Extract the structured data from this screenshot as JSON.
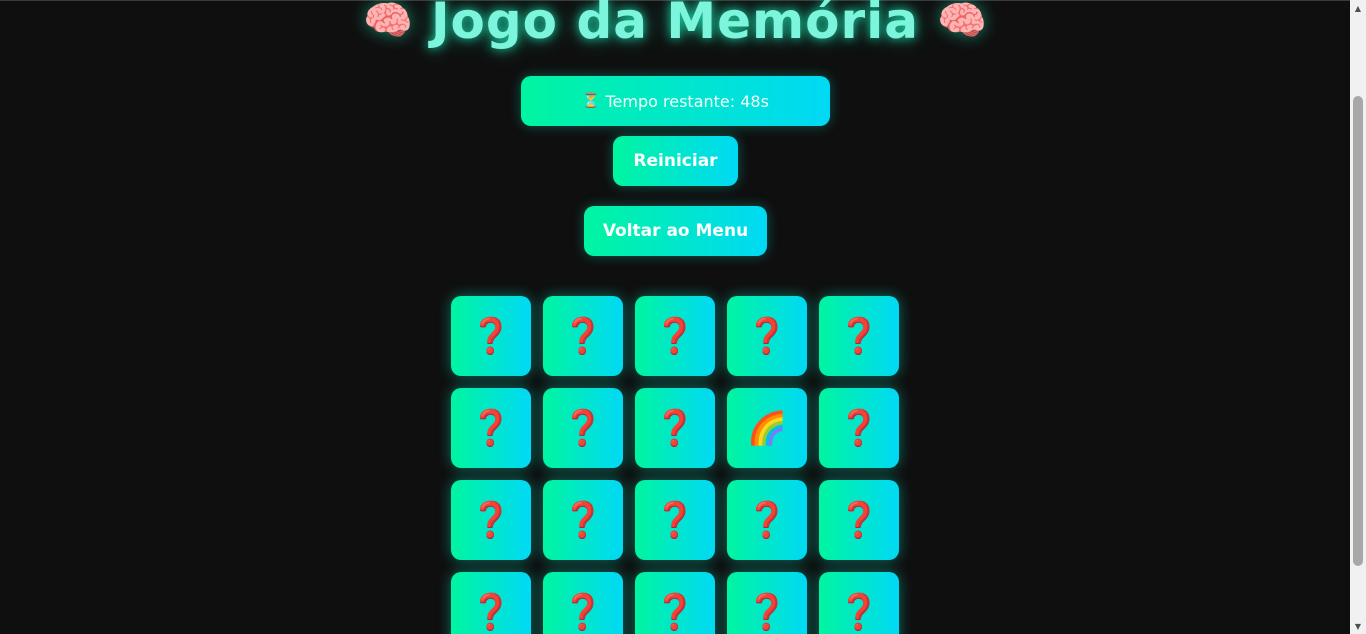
{
  "page": {
    "title": "Jogo da Memória",
    "title_icon": "brain-emoji",
    "title_icon_glyph": "🧠"
  },
  "timer": {
    "icon": "hourglass-icon",
    "icon_glyph": "⏳",
    "label": "Tempo restante: 48s"
  },
  "controls": {
    "restart_label": "Reiniciar",
    "menu_label": "Voltar ao Menu"
  },
  "board": {
    "columns": 5,
    "cards": [
      {
        "face": "❓",
        "revealed": false
      },
      {
        "face": "❓",
        "revealed": false
      },
      {
        "face": "❓",
        "revealed": false
      },
      {
        "face": "❓",
        "revealed": false
      },
      {
        "face": "❓",
        "revealed": false
      },
      {
        "face": "❓",
        "revealed": false
      },
      {
        "face": "❓",
        "revealed": false
      },
      {
        "face": "❓",
        "revealed": false
      },
      {
        "face": "🌈",
        "revealed": true
      },
      {
        "face": "❓",
        "revealed": false
      },
      {
        "face": "❓",
        "revealed": false
      },
      {
        "face": "❓",
        "revealed": false
      },
      {
        "face": "❓",
        "revealed": false
      },
      {
        "face": "❓",
        "revealed": false
      },
      {
        "face": "❓",
        "revealed": false
      },
      {
        "face": "❓",
        "revealed": false
      },
      {
        "face": "❓",
        "revealed": false
      },
      {
        "face": "❓",
        "revealed": false
      },
      {
        "face": "❓",
        "revealed": false
      },
      {
        "face": "❓",
        "revealed": false
      }
    ]
  },
  "colors": {
    "background": "#0f0f0f",
    "gradient_start": "#00f5a0",
    "gradient_end": "#00d9f5",
    "title": "#7df5dc",
    "question_mark": "#e8365d"
  },
  "scrollbar": {
    "up_icon": "scroll-up-arrow-icon",
    "down_icon": "scroll-down-arrow-icon"
  }
}
